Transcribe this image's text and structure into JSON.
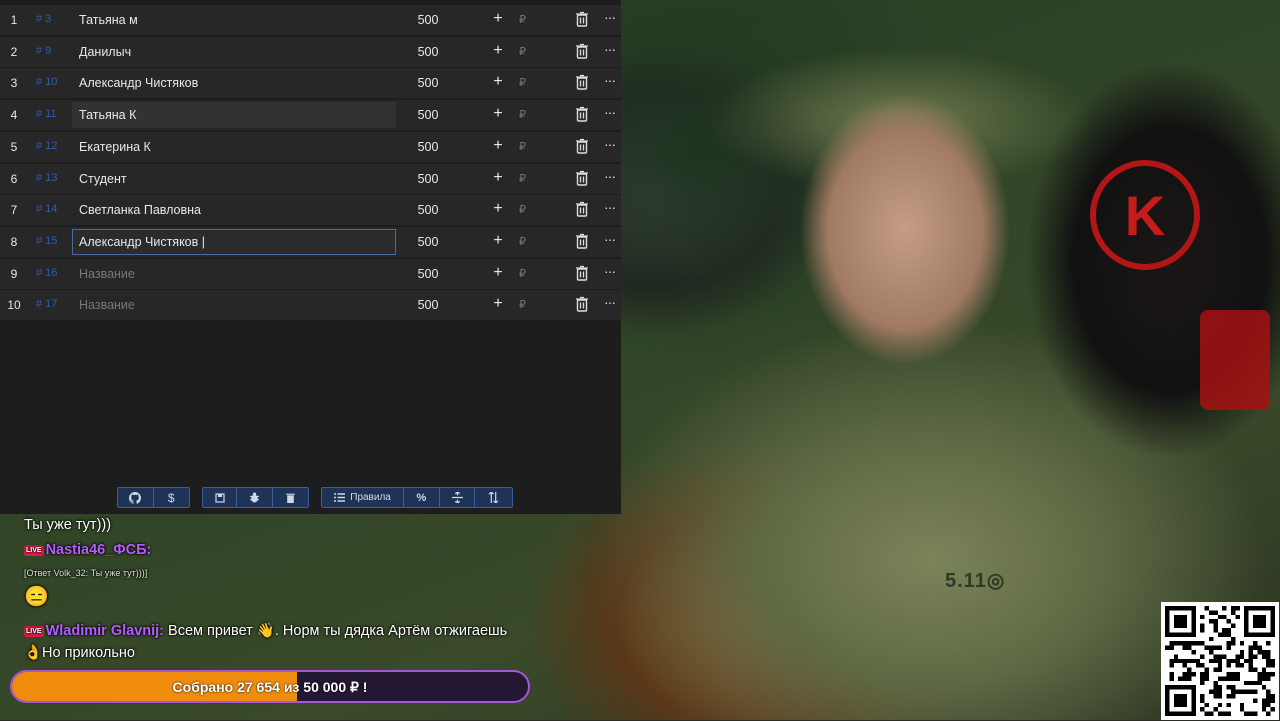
{
  "rows": [
    {
      "num": "1",
      "id": "# 3",
      "name": "Татьяна м",
      "placeholder": false,
      "amount": "500"
    },
    {
      "num": "2",
      "id": "# 9",
      "name": "Данилыч",
      "placeholder": false,
      "amount": "500"
    },
    {
      "num": "3",
      "id": "# 10",
      "name": "Александр Чистяков",
      "placeholder": false,
      "amount": "500"
    },
    {
      "num": "4",
      "id": "# 11",
      "name": "Татьяна К",
      "placeholder": false,
      "amount": "500"
    },
    {
      "num": "5",
      "id": "# 12",
      "name": "Екатерина К",
      "placeholder": false,
      "amount": "500"
    },
    {
      "num": "6",
      "id": "# 13",
      "name": "Студент",
      "placeholder": false,
      "amount": "500"
    },
    {
      "num": "7",
      "id": "# 14",
      "name": "Светланка Павловна",
      "placeholder": false,
      "amount": "500"
    },
    {
      "num": "8",
      "id": "# 15",
      "name": "Александр Чистяков |",
      "placeholder": false,
      "amount": "500"
    },
    {
      "num": "9",
      "id": "# 16",
      "name": "Название",
      "placeholder": true,
      "amount": "500"
    },
    {
      "num": "10",
      "id": "# 17",
      "name": "Название",
      "placeholder": true,
      "amount": "500"
    }
  ],
  "row_icons": {
    "plus": "+",
    "currency": "₽",
    "delete": "trash-icon",
    "more": "···"
  },
  "toolbar": {
    "github": "github-icon",
    "dollar": "$",
    "rules_label": "Правила",
    "percent": "%"
  },
  "chat": {
    "line0": "Ты уже тут)))",
    "line1_nick": "Nastia46_ФСБ:",
    "line1_reply": "[Ответ Volk_32: Ты уже тут)))]",
    "line2_emoji": "😑",
    "line3_nick": "Wladimir Glavnij:",
    "line3_text": "Всем привет 👋. Норм ты дядка Артём отжигаешь",
    "line4": "👌Но прикольно",
    "live_badge": "LIVE"
  },
  "goal": {
    "collected_label": "Собрано 27 654",
    "of_label": "из",
    "target_label": "50 000 ₽ !",
    "progress": 0.553
  },
  "stream": {
    "chair_logo": "K",
    "shirt_text": "5.11◎"
  }
}
